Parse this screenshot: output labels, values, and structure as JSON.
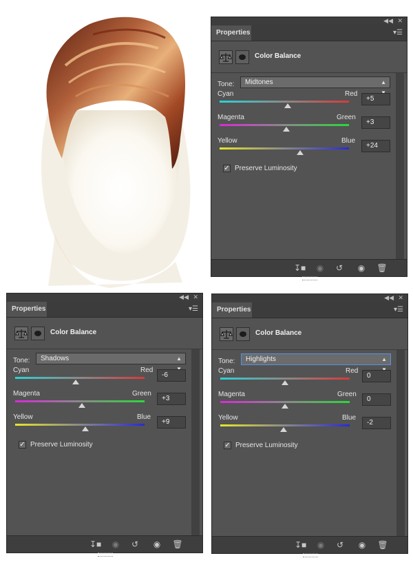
{
  "panels": [
    {
      "tab_label": "Properties",
      "title": "Color Balance",
      "tone_label": "Tone:",
      "tone_value": "Midtones",
      "rows": [
        {
          "left": "Cyan",
          "right": "Red",
          "value": "+5",
          "level": 5,
          "gradient": [
            "#2ad2d8",
            "#8a8a8a",
            "#d83a3a"
          ]
        },
        {
          "left": "Magenta",
          "right": "Green",
          "value": "+3",
          "level": 3,
          "gradient": [
            "#d82ad8",
            "#8a8a8a",
            "#2ad83a"
          ]
        },
        {
          "left": "Yellow",
          "right": "Blue",
          "value": "+24",
          "level": 24,
          "gradient": [
            "#e6e62a",
            "#8a8a8a",
            "#2a2ad8"
          ]
        }
      ],
      "preserve_label": "Preserve Luminosity",
      "preserve_checked": true
    },
    {
      "tab_label": "Properties",
      "title": "Color Balance",
      "tone_label": "Tone:",
      "tone_value": "Shadows",
      "rows": [
        {
          "left": "Cyan",
          "right": "Red",
          "value": "-6",
          "level": -6,
          "gradient": [
            "#2ad2d8",
            "#8a8a8a",
            "#d83a3a"
          ]
        },
        {
          "left": "Magenta",
          "right": "Green",
          "value": "+3",
          "level": 3,
          "gradient": [
            "#d82ad8",
            "#8a8a8a",
            "#2ad83a"
          ]
        },
        {
          "left": "Yellow",
          "right": "Blue",
          "value": "+9",
          "level": 9,
          "gradient": [
            "#e6e62a",
            "#8a8a8a",
            "#2a2ad8"
          ]
        }
      ],
      "preserve_label": "Preserve Luminosity",
      "preserve_checked": true
    },
    {
      "tab_label": "Properties",
      "title": "Color Balance",
      "tone_label": "Tone:",
      "tone_value": "Highlights",
      "rows": [
        {
          "left": "Cyan",
          "right": "Red",
          "value": "0",
          "level": 0,
          "gradient": [
            "#2ad2d8",
            "#8a8a8a",
            "#d83a3a"
          ]
        },
        {
          "left": "Magenta",
          "right": "Green",
          "value": "0",
          "level": 0,
          "gradient": [
            "#d82ad8",
            "#8a8a8a",
            "#2ad83a"
          ]
        },
        {
          "left": "Yellow",
          "right": "Blue",
          "value": "-2",
          "level": -2,
          "gradient": [
            "#e6e62a",
            "#8a8a8a",
            "#2a2ad8"
          ]
        }
      ],
      "preserve_label": "Preserve Luminosity",
      "preserve_checked": true
    }
  ],
  "topbar_icons": [
    "collapse-icon",
    "close-icon"
  ],
  "bottom_icons": [
    "clip-to-layer-icon",
    "view-previous-icon",
    "reset-icon",
    "visibility-eye-icon",
    "trash-icon"
  ],
  "colors": {
    "panel": "#535353",
    "hair": "#8a3a22",
    "face": "#ffffff"
  }
}
